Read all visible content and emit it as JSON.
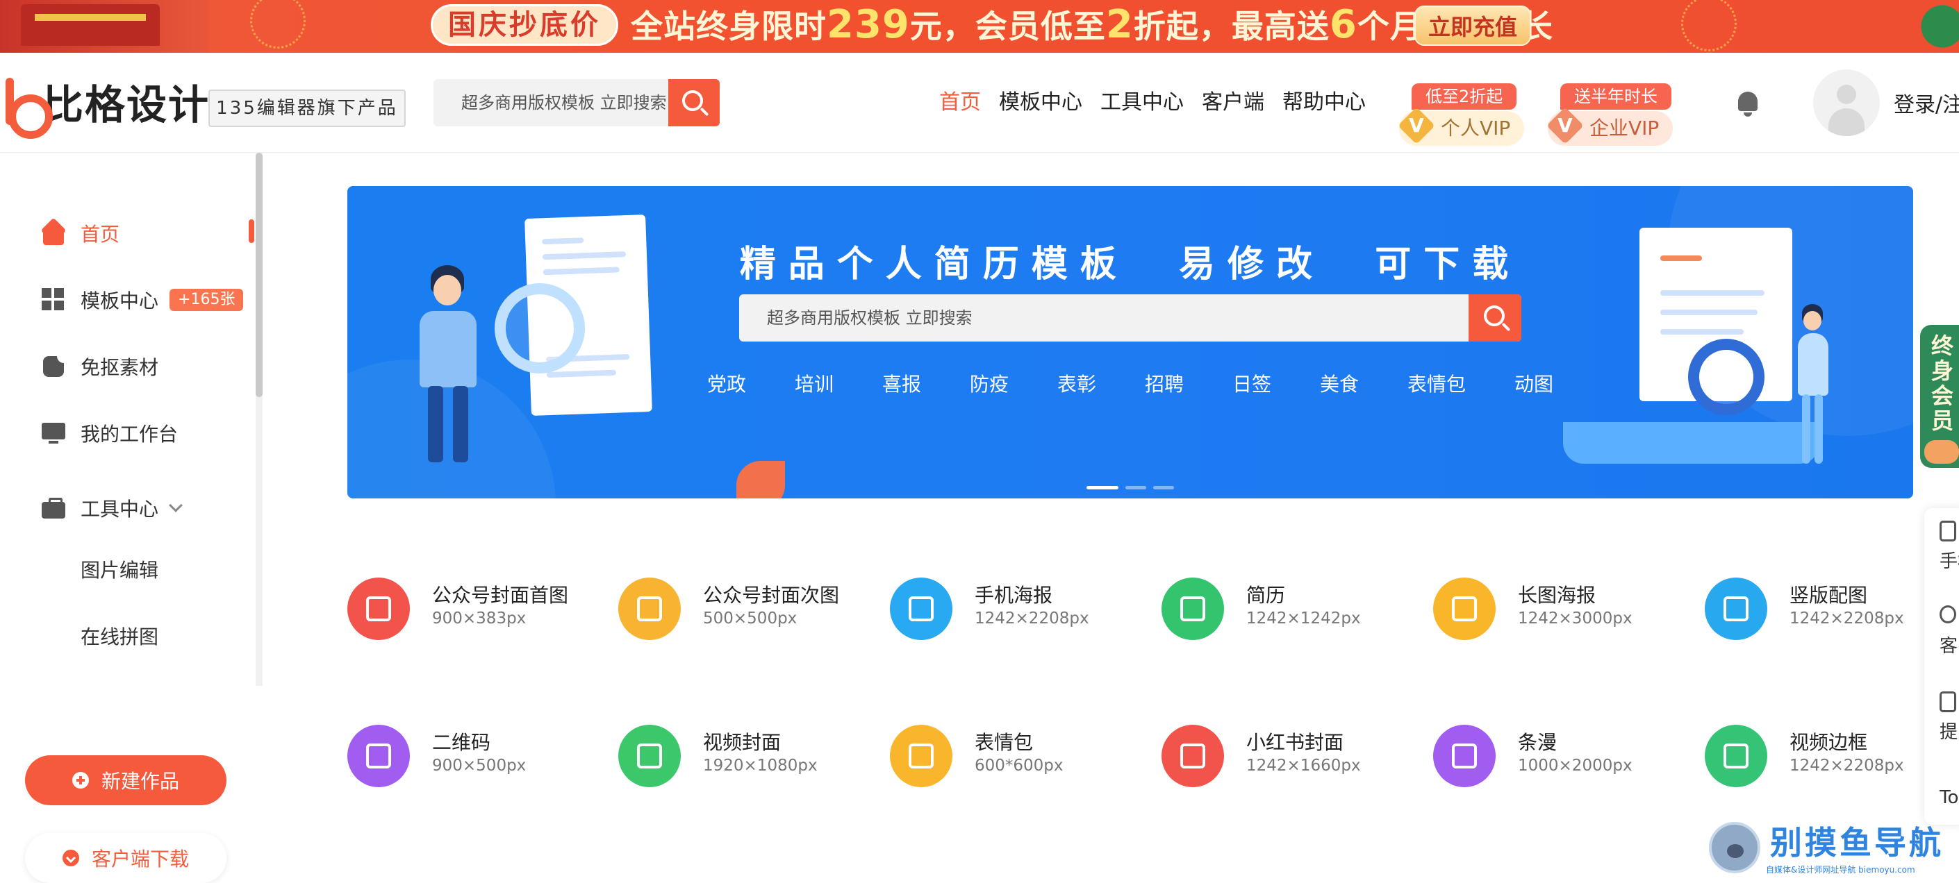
{
  "promo": {
    "tag": "国庆抄底价",
    "text_prefix": "全站终身限时",
    "text_price": "239",
    "text_mid": "元，会员低至",
    "text_discount": "2",
    "text_mid2": "折起，最高送",
    "text_months": "6",
    "text_suffix": "个月会员时长",
    "cta": "立即充值"
  },
  "header": {
    "logo_text": "比格设计",
    "slogan": "135编辑器旗下产品",
    "search_placeholder": "超多商用版权模板 立即搜索",
    "nav": [
      "首页",
      "模板中心",
      "工具中心",
      "客户端",
      "帮助中心"
    ],
    "nav_active": "首页",
    "vip_personal": {
      "badge": "低至2折起",
      "label": "个人VIP",
      "mark": "V"
    },
    "vip_enterprise": {
      "badge": "送半年时长",
      "label": "企业VIP",
      "mark": "V"
    },
    "login": "登录/注"
  },
  "sidebar": {
    "items": [
      {
        "label": "首页",
        "icon": "home-icon"
      },
      {
        "label": "模板中心",
        "icon": "template-grid-icon",
        "badge": "+165张"
      },
      {
        "label": "免抠素材",
        "icon": "sticker-icon"
      },
      {
        "label": "我的工作台",
        "icon": "monitor-icon"
      },
      {
        "label": "工具中心",
        "icon": "briefcase-icon"
      }
    ],
    "sub_items": [
      "图片编辑",
      "在线拼图"
    ],
    "new_work": "新建作品",
    "client_download": "客户端下载"
  },
  "hero": {
    "title_part1": "精品个人简历模板",
    "title_part2": "易修改",
    "title_part3": "可下载",
    "search_placeholder": "超多商用版权模板 立即搜索",
    "tags": [
      "党政",
      "培训",
      "喜报",
      "防疫",
      "表彰",
      "招聘",
      "日签",
      "美食",
      "表情包",
      "动图"
    ],
    "slide_count": 3,
    "active_slide": 1
  },
  "categories": [
    {
      "name": "公众号封面首图",
      "size": "900×383px",
      "color": "#f2544c",
      "icon": "wechat-cover-icon"
    },
    {
      "name": "公众号封面次图",
      "size": "500×500px",
      "color": "#f8b430",
      "icon": "wechat-secondary-icon"
    },
    {
      "name": "手机海报",
      "size": "1242×2208px",
      "color": "#29a9f1",
      "icon": "phone-poster-icon"
    },
    {
      "name": "简历",
      "size": "1242×1242px",
      "color": "#33c46d",
      "icon": "resume-icon"
    },
    {
      "name": "长图海报",
      "size": "1242×3000px",
      "color": "#f9b62a",
      "icon": "long-poster-icon"
    },
    {
      "name": "竖版配图",
      "size": "1242×2208px",
      "color": "#28a8ee",
      "icon": "vertical-image-icon"
    },
    {
      "name": "二维码",
      "size": "900×500px",
      "color": "#a15cf0",
      "icon": "qrcode-icon"
    },
    {
      "name": "视频封面",
      "size": "1920×1080px",
      "color": "#3cc86a",
      "icon": "video-cover-icon"
    },
    {
      "name": "表情包",
      "size": "600*600px",
      "color": "#f9b52b",
      "icon": "emoji-icon"
    },
    {
      "name": "小红书封面",
      "size": "1242×1660px",
      "color": "#f2544c",
      "icon": "xiaohongshu-icon"
    },
    {
      "name": "条漫",
      "size": "1000×2000px",
      "color": "#a15cf0",
      "icon": "comic-strip-icon"
    },
    {
      "name": "视频边框",
      "size": "1242×2208px",
      "color": "#35c475",
      "icon": "video-frame-icon"
    }
  ],
  "float": {
    "vip_text": "终身会员",
    "tools": [
      "手机",
      "客",
      "提",
      "To"
    ]
  },
  "watermark": {
    "big": "别摸鱼导航",
    "small": "自媒体&设计师网址导航 biemoyu.com"
  }
}
